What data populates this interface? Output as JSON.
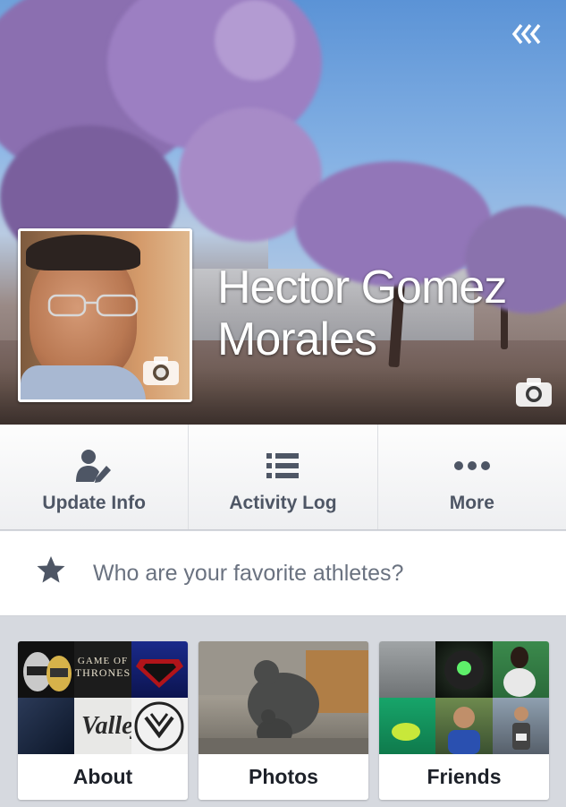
{
  "profile": {
    "name": "Hector Gomez Morales"
  },
  "actions": [
    {
      "label": "Update Info",
      "icon": "edit-profile-icon"
    },
    {
      "label": "Activity Log",
      "icon": "list-icon"
    },
    {
      "label": "More",
      "icon": "more-dots-icon"
    }
  ],
  "prompt": {
    "text": "Who are your favorite athletes?",
    "icon": "star-icon"
  },
  "tiles": [
    {
      "label": "About"
    },
    {
      "label": "Photos"
    },
    {
      "label": "Friends"
    }
  ],
  "about_thumb_text": {
    "got_line1": "GAME OF",
    "got_line2": "THRONES",
    "vallej": "Vallej"
  },
  "colors": {
    "action_text": "#4e5665",
    "prompt_text": "#6a7280",
    "tile_label": "#1d2129",
    "background": "#d6d9df"
  }
}
